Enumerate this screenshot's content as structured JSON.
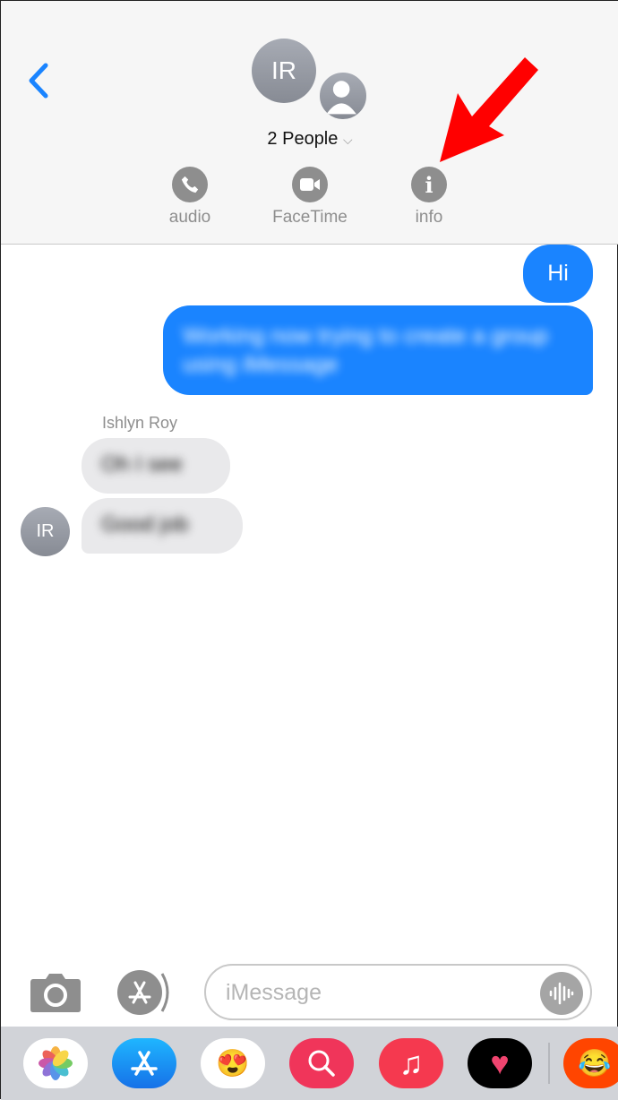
{
  "header": {
    "avatar_initials": "IR",
    "title": "2 People",
    "actions": [
      {
        "label": "audio",
        "icon": "phone-icon"
      },
      {
        "label": "FaceTime",
        "icon": "video-camera-icon"
      },
      {
        "label": "info",
        "icon": "info-icon"
      }
    ]
  },
  "annotation": {
    "arrow_color": "#ff0000"
  },
  "messages": [
    {
      "from": "me",
      "text": "Hi"
    },
    {
      "from": "me",
      "text": "Working now trying to create a group using iMessage",
      "blurred": true
    },
    {
      "from": "Ishlyn Roy",
      "text": "Oh I see",
      "blurred": true
    },
    {
      "from": "Ishlyn Roy",
      "text": "Good job",
      "blurred": true
    }
  ],
  "sender_name": "Ishlyn Roy",
  "sender_initials": "IR",
  "composer": {
    "placeholder": "iMessage"
  },
  "colors": {
    "accent": "#1a84ff",
    "incoming": "#e9e9eb"
  },
  "tray": [
    "photos-app-icon",
    "app-store-icon",
    "memoji-icon",
    "image-search-icon",
    "music-icon",
    "heart-app-icon",
    "reddit-icon"
  ]
}
